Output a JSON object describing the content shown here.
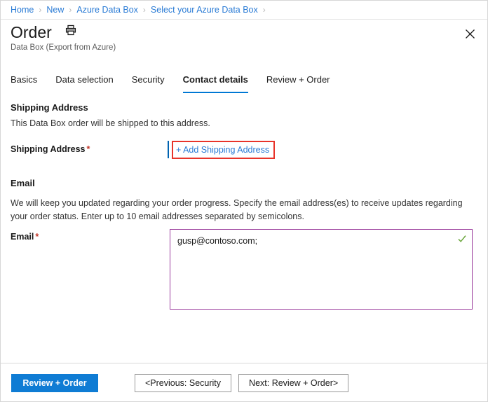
{
  "breadcrumb": {
    "items": [
      {
        "label": "Home"
      },
      {
        "label": "New"
      },
      {
        "label": "Azure Data Box"
      },
      {
        "label": "Select your Azure Data Box"
      }
    ],
    "separator": "›"
  },
  "header": {
    "title": "Order",
    "subtitle": "Data Box (Export from Azure)",
    "print_icon": "printer-icon",
    "close_icon": "close-icon"
  },
  "tabs": [
    {
      "label": "Basics",
      "active": false
    },
    {
      "label": "Data selection",
      "active": false
    },
    {
      "label": "Security",
      "active": false
    },
    {
      "label": "Contact details",
      "active": true
    },
    {
      "label": "Review + Order",
      "active": false
    }
  ],
  "shipping": {
    "heading": "Shipping Address",
    "description": "This Data Box order will be shipped to this address.",
    "field_label": "Shipping Address",
    "required_marker": "*",
    "add_link": "+ Add Shipping Address"
  },
  "email": {
    "heading": "Email",
    "description": "We will keep you updated regarding your order progress. Specify the email address(es) to receive updates regarding your order status. Enter up to 10 email addresses separated by semicolons.",
    "field_label": "Email",
    "required_marker": "*",
    "value": "gusp@contoso.com;",
    "placeholder": "",
    "valid_icon": "check-icon"
  },
  "footer": {
    "primary_label": "Review + Order",
    "previous_label": "<Previous: Security",
    "next_label": "Next: Review + Order>"
  },
  "colors": {
    "accent_blue": "#0078d4",
    "link_blue": "#2a7bd5",
    "primary_button": "#0f7cd4",
    "required_red": "#c3392c",
    "highlight_red": "#e8342a",
    "field_purple": "#9a3c9c",
    "valid_green": "#6aa63c"
  }
}
